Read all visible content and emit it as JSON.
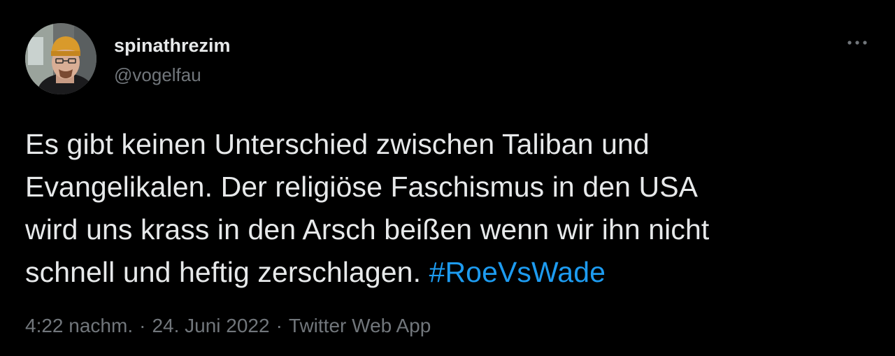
{
  "tweet": {
    "author": {
      "display_name": "spinathrezim",
      "handle": "@vogelfau",
      "avatar_icon": "user-avatar"
    },
    "more_icon": "more-options-icon",
    "text_lines": [
      "Es gibt keinen Unterschied zwischen Taliban und",
      "Evangelikalen. Der religiöse Faschismus in den USA",
      "wird uns krass in den Arsch beißen wenn wir ihn nicht",
      "schnell und heftig zerschlagen. "
    ],
    "hashtag": "#RoeVsWade",
    "meta": {
      "time": "4:22 nachm.",
      "separator": "·",
      "date": "24. Juni 2022",
      "source": "Twitter Web App"
    }
  },
  "colors": {
    "background": "#000000",
    "text_primary": "#e7e9ea",
    "text_secondary": "#71767b",
    "link": "#1d9bf0"
  }
}
